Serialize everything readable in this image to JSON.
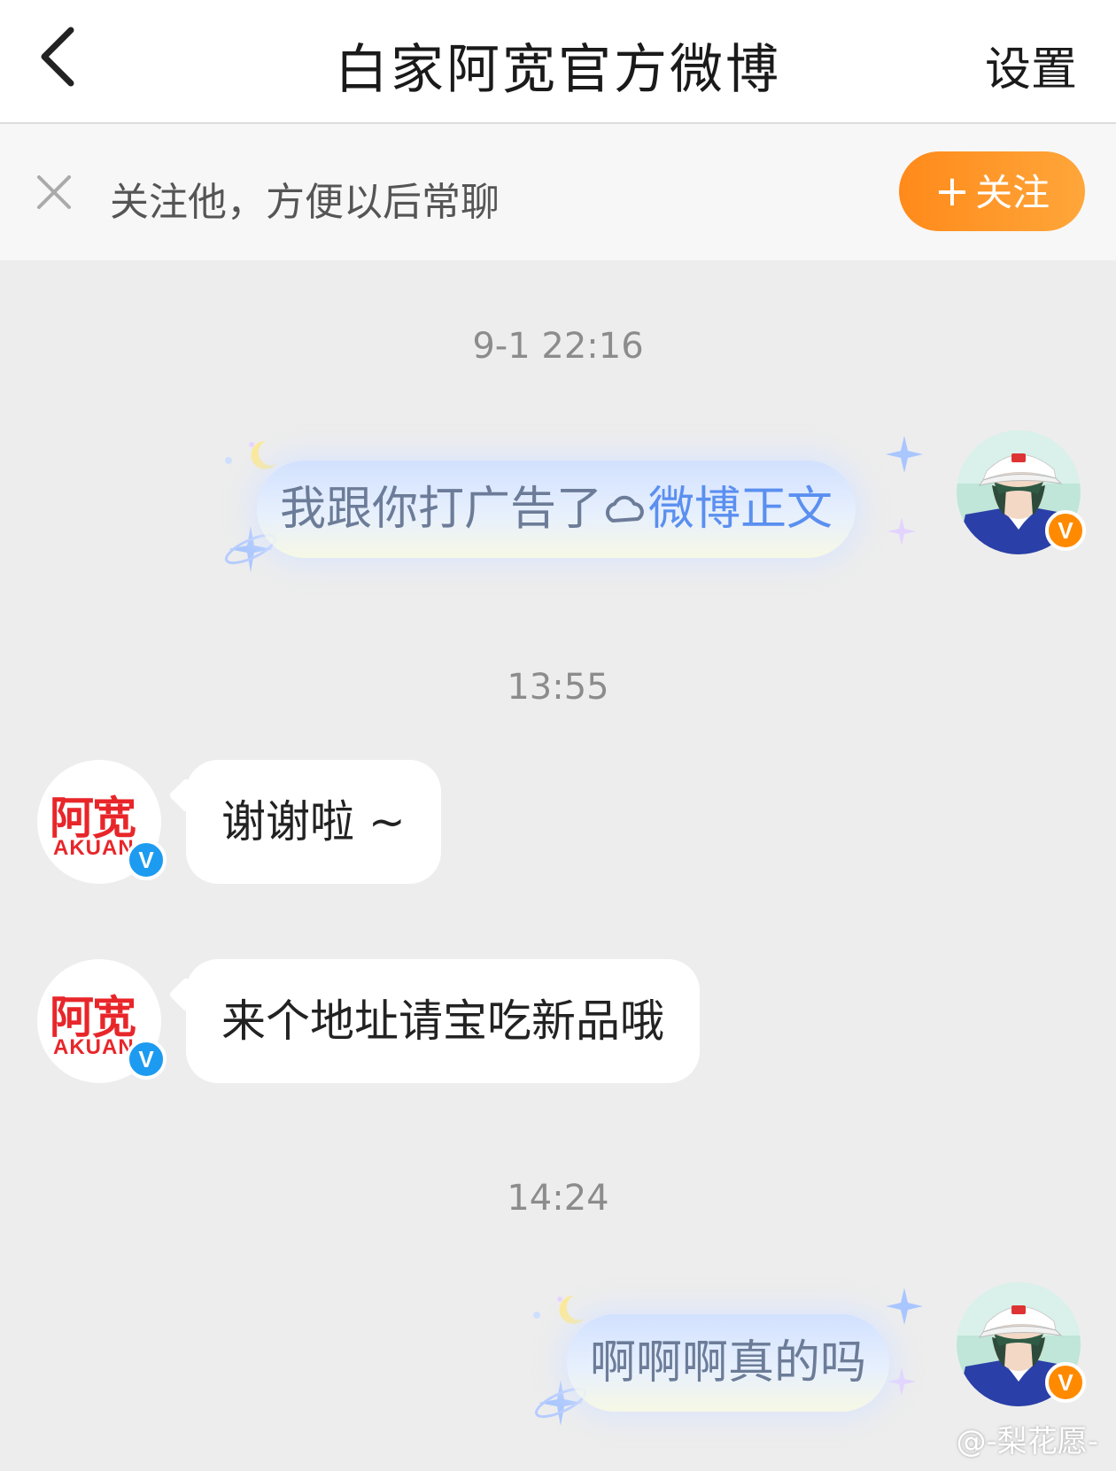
{
  "header": {
    "title": "白家阿宽官方微博",
    "settings_label": "设置"
  },
  "follow_bar": {
    "prompt": "关注他，方便以后常聊",
    "button_plus": "+",
    "button_label": "关注"
  },
  "messages": [
    {
      "type": "timestamp",
      "text": "9-1 22:16"
    },
    {
      "type": "outgoing",
      "text": "我跟你打广告了",
      "link_text": "微博正文",
      "badge": "V"
    },
    {
      "type": "timestamp",
      "text": "13:55"
    },
    {
      "type": "incoming",
      "text": "谢谢啦 ~",
      "badge": "V"
    },
    {
      "type": "incoming",
      "text": "来个地址请宝吃新品哦",
      "badge": "V"
    },
    {
      "type": "timestamp",
      "text": "14:24"
    },
    {
      "type": "outgoing",
      "text": "啊啊啊真的吗",
      "badge": "V"
    }
  ],
  "brand": {
    "logo_cn": "阿宽",
    "logo_en": "AKUAN"
  },
  "watermark": "@-梨花愿-",
  "colors": {
    "accent_orange": "#ff8a1a",
    "verified_blue": "#1d9bf0",
    "link_blue": "#5b8ff0",
    "brand_red": "#e8262a"
  }
}
